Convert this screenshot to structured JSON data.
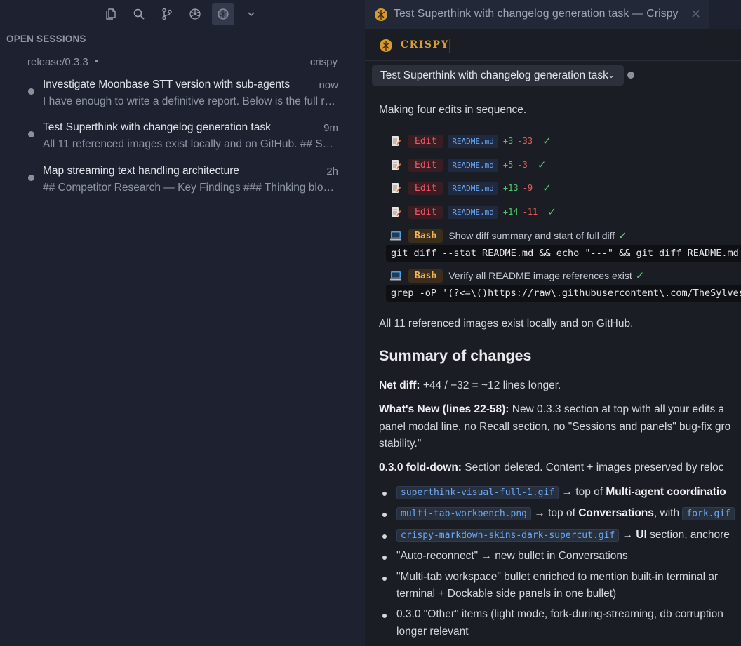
{
  "sidebar": {
    "toolbar": {
      "icons": [
        "files-icon",
        "search-icon",
        "source-control-icon",
        "openai-icon",
        "crispy-icon",
        "chevron-down-icon"
      ]
    },
    "section_title": "OPEN SESSIONS",
    "branch": "release/0.3.3",
    "branch_sep": "•",
    "repo": "crispy",
    "sessions": [
      {
        "title": "Investigate Moonbase STT version with sub-agents",
        "time": "now",
        "preview": "I have enough to write a definitive report. Below is the full report."
      },
      {
        "title": "Test Superthink with changelog generation task",
        "time": "9m",
        "preview": "All 11 referenced images exist locally and on GitHub. ## Summary of changes"
      },
      {
        "title": "Map streaming text handling architecture",
        "time": "2h",
        "preview": "## Competitor Research — Key Findings ### Thinking blocks"
      }
    ]
  },
  "tab": {
    "title": "Test Superthink with changelog generation task — Crispy",
    "close": "✕"
  },
  "header": {
    "app_name": "CRISPY",
    "task_title": "Test Superthink with changelog generation task",
    "chevron": "⌄"
  },
  "content": {
    "intro": "Making four edits in sequence.",
    "edits": [
      {
        "label": "Edit",
        "file": "README.md",
        "plus": "+3",
        "minus": "-33",
        "check": "✓"
      },
      {
        "label": "Edit",
        "file": "README.md",
        "plus": "+5",
        "minus": "-3",
        "check": "✓"
      },
      {
        "label": "Edit",
        "file": "README.md",
        "plus": "+13",
        "minus": "-9",
        "check": "✓"
      },
      {
        "label": "Edit",
        "file": "README.md",
        "plus": "+14",
        "minus": "-11",
        "check": "✓"
      }
    ],
    "bash": [
      {
        "label": "Bash",
        "desc": "Show diff summary and start of full diff",
        "check": "✓",
        "cmd": "git diff --stat README.md && echo \"---\" && git diff README.md | head"
      },
      {
        "label": "Bash",
        "desc": "Verify all README image references exist",
        "check": "✓",
        "cmd": "grep -oP '(?<=\\()https://raw\\.githubusercontent\\.com/TheSylvester/"
      }
    ],
    "after_bash": "All 11 referenced images exist locally and on GitHub.",
    "summary_heading": "Summary of changes",
    "net_diff_label": "Net diff:",
    "net_diff_text": " +44 / −32 = ~12 lines longer.",
    "whats_new_label": "What's New (lines 22-58):",
    "whats_new_line1": " New 0.3.3 section at top with all your edits a",
    "whats_new_line2": "panel modal line, no Recall section, no \"Sessions and panels\" bug-fix gro",
    "whats_new_line3": "stability.\"",
    "folddown_label": "0.3.0 fold-down:",
    "folddown_text": " Section deleted. Content + images preserved by reloc",
    "bullets": [
      {
        "code": "superthink-visual-full-1.gif",
        "text": " → top of ",
        "bold": "Multi-agent coordinatio"
      },
      {
        "code": "multi-tab-workbench.png",
        "text": " → top of ",
        "bold": "Conversations",
        "tail": ", with ",
        "code2": "fork.gif"
      },
      {
        "code": "crispy-markdown-skins-dark-supercut.gif",
        "text": " → ",
        "bold": "UI",
        "tail": " section, anchore"
      },
      {
        "text": "\"Auto-reconnect\" → new bullet in Conversations"
      },
      {
        "text": "\"Multi-tab workspace\" bullet enriched to mention built-in terminal ar",
        "line2": "terminal + Dockable side panels in one bullet)"
      },
      {
        "text": "0.3.0 \"Other\" items (light mode, fork-during-streaming, db corruption",
        "line2": "longer relevant"
      }
    ]
  }
}
